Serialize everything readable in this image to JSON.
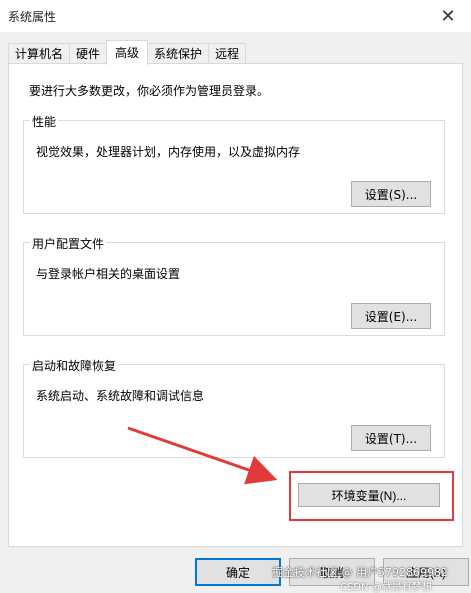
{
  "window": {
    "title": "系统属性",
    "close_glyph": "✕"
  },
  "tabs": [
    {
      "label": "计算机名"
    },
    {
      "label": "硬件"
    },
    {
      "label": "高级",
      "active": true
    },
    {
      "label": "系统保护"
    },
    {
      "label": "远程"
    }
  ],
  "advanced": {
    "intro": "要进行大多数更改，你必须作为管理员登录。",
    "performance": {
      "title": "性能",
      "desc": "视觉效果，处理器计划，内存使用，以及虚拟内存",
      "button": "设置(S)..."
    },
    "user_profiles": {
      "title": "用户配置文件",
      "desc": "与登录帐户相关的桌面设置",
      "button": "设置(E)..."
    },
    "startup_recovery": {
      "title": "启动和故障恢复",
      "desc": "系统启动、系统故障和调试信息",
      "button": "设置(T)..."
    },
    "env_button": "环境变量(N)..."
  },
  "footer": {
    "ok": "确定",
    "cancel": "取消",
    "apply": "应用(A)"
  },
  "annotations": {
    "highlight_color": "#e03a3a",
    "arrow_color": "#e03a3a"
  },
  "watermark": {
    "line1": "掘金技术社区 @ 用户5792869982",
    "line2": "CSDN @就是有梦想"
  }
}
